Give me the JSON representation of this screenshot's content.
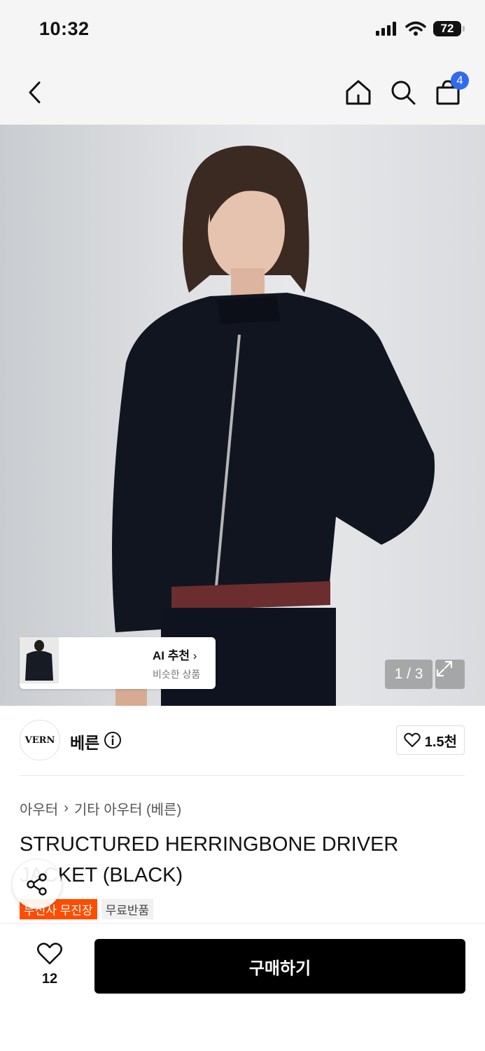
{
  "status": {
    "time": "10:32",
    "battery": "72"
  },
  "nav": {
    "cart_count": "4"
  },
  "gallery": {
    "ai_title": "AI 추천",
    "ai_subtitle": "비슷한 상품",
    "counter": "1 / 3"
  },
  "brand": {
    "logo_text": "VERN",
    "name": "베른",
    "likes": "1.5천"
  },
  "breadcrumb": {
    "level1": "아우터",
    "level2": "기타 아우터 (베른)"
  },
  "product": {
    "title": "STRUCTURED HERRINGBONE DRIVER JACKET (BLACK)",
    "tags": [
      "무신사 무진장",
      "무료반품"
    ]
  },
  "bottom": {
    "fav_count": "12",
    "buy_label": "구매하기"
  }
}
